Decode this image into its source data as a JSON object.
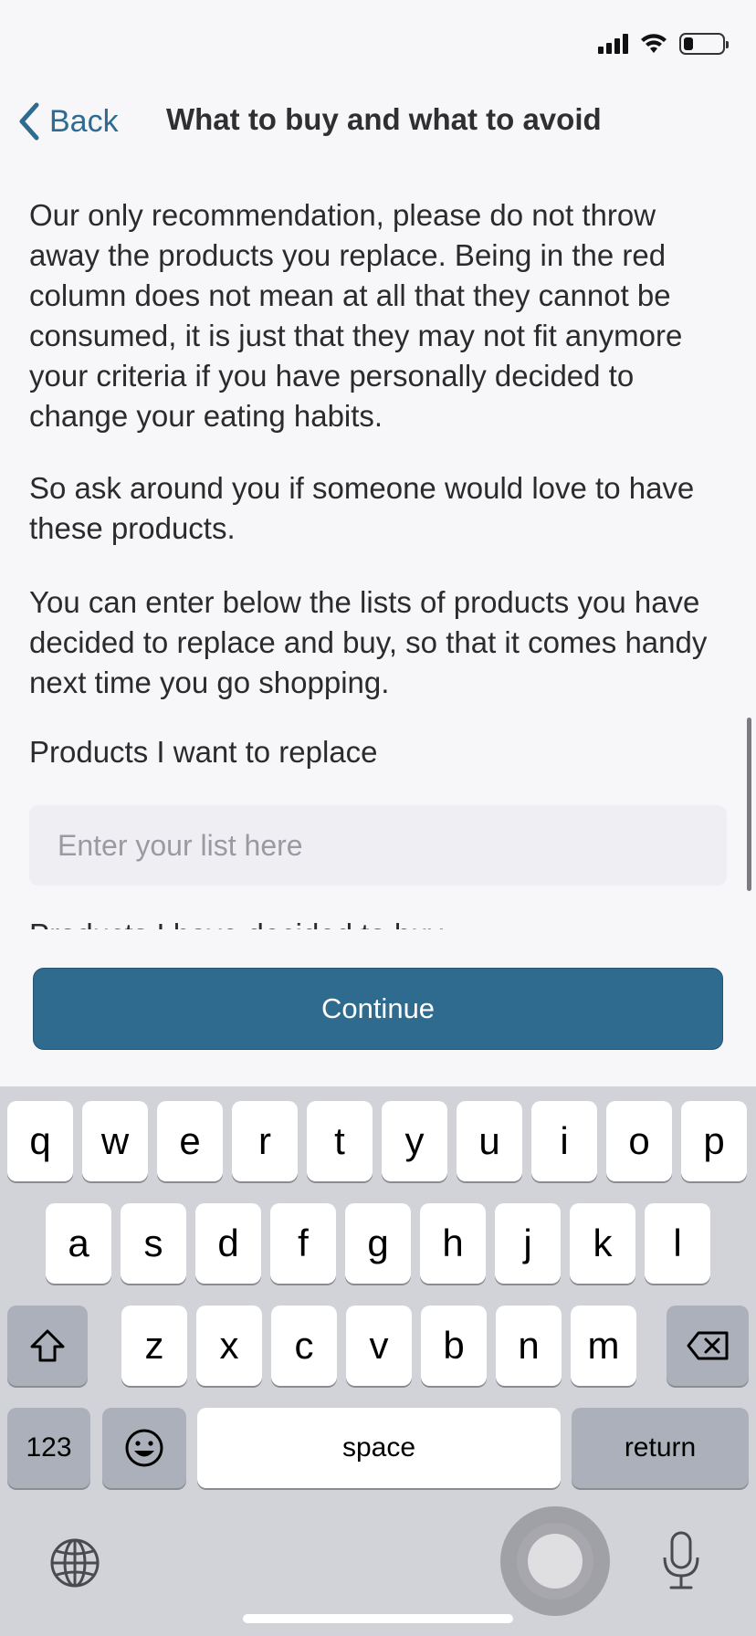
{
  "status_bar": {
    "battery_level": 0.25
  },
  "nav": {
    "back_label": "Back",
    "title": "What to buy and what to avoid"
  },
  "content": {
    "paragraphs": [
      "Our only recommendation, please do not throw away the products you replace. Being in the red column does not mean at all that they cannot be consumed, it is just that they may not fit anymore your criteria if you have personally decided to change your eating habits.",
      "So ask around you if someone would love to have these products.",
      "You can enter below the lists of products you have decided to replace and buy, so that it comes handy next time you go shopping."
    ],
    "replace_label": "Products I want to replace",
    "replace_placeholder": "Enter your list here",
    "buy_label_partial": "Products I have decided to buy"
  },
  "actions": {
    "continue_label": "Continue"
  },
  "colors": {
    "accent": "#2e6b8e",
    "background": "#f7f7fa",
    "keyboard": "#d1d3d9"
  },
  "keyboard": {
    "row1": [
      "q",
      "w",
      "e",
      "r",
      "t",
      "y",
      "u",
      "i",
      "o",
      "p"
    ],
    "row2": [
      "a",
      "s",
      "d",
      "f",
      "g",
      "h",
      "j",
      "k",
      "l"
    ],
    "row3": [
      "z",
      "x",
      "c",
      "v",
      "b",
      "n",
      "m"
    ],
    "numbers_label": "123",
    "space_label": "space",
    "return_label": "return",
    "icons": [
      "shift-icon",
      "delete-icon",
      "emoji-icon",
      "globe-icon",
      "microphone-icon"
    ]
  }
}
